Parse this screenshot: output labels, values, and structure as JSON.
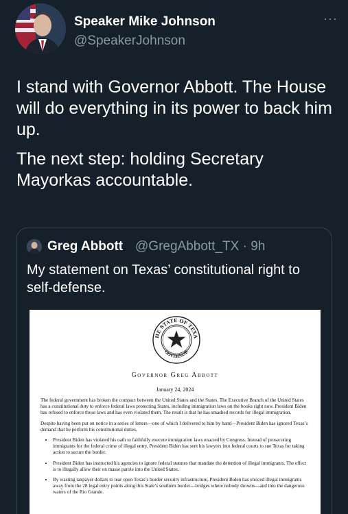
{
  "author": {
    "display_name": "Speaker Mike Johnson",
    "handle": "@SpeakerJohnson",
    "more_label": "···"
  },
  "tweet": {
    "paragraphs": [
      "I stand with Governor Abbott. The House will do everything in its power to back him up.",
      "The next step: holding Secretary Mayorkas accountable."
    ]
  },
  "quote": {
    "display_name": "Greg Abbott",
    "handle_time": "@GregAbbott_TX · 9h",
    "text": "My statement on Texas’ constitutional right to self-defense."
  },
  "document": {
    "seal_text_top": "THE STATE OF TEXAS",
    "seal_text_bottom": "GOVERNOR",
    "title": "Governor Greg Abbott",
    "date": "January 24, 2024",
    "paragraphs": [
      "The federal government has broken the compact between the United States and the States. The Executive Branch of the United States has a constitutional duty to enforce federal laws protecting States, including immigration laws on the books right now. President Biden has refused to enforce those laws and has even violated them. The result is that he has smashed records for illegal immigration.",
      "Despite having been put on notice in a series of letters—one of which I delivered to him by hand—President Biden has ignored Texas’s demand that he perform his constitutional duties."
    ],
    "bullets": [
      "President Biden has violated his oath to faithfully execute immigration laws enacted by Congress. Instead of prosecuting immigrants for the federal crime of illegal entry, President Biden has sent his lawyers into federal courts to sue Texas for taking action to secure the border.",
      "President Biden has instructed his agencies to ignore federal statutes that mandate the detention of illegal immigrants. The effect is to illegally allow their en masse parole into the United States.",
      "By wasting taxpayer dollars to tear open Texas’s border security infrastructure, President Biden has enticed illegal immigrants away from the 28 legal entry points along this State’s southern border—bridges where nobody drowns—and into the dangerous waters of the Rio Grande."
    ]
  },
  "colors": {
    "background": "#15202b",
    "secondary_text": "#8b98a5",
    "border": "#38444d"
  }
}
